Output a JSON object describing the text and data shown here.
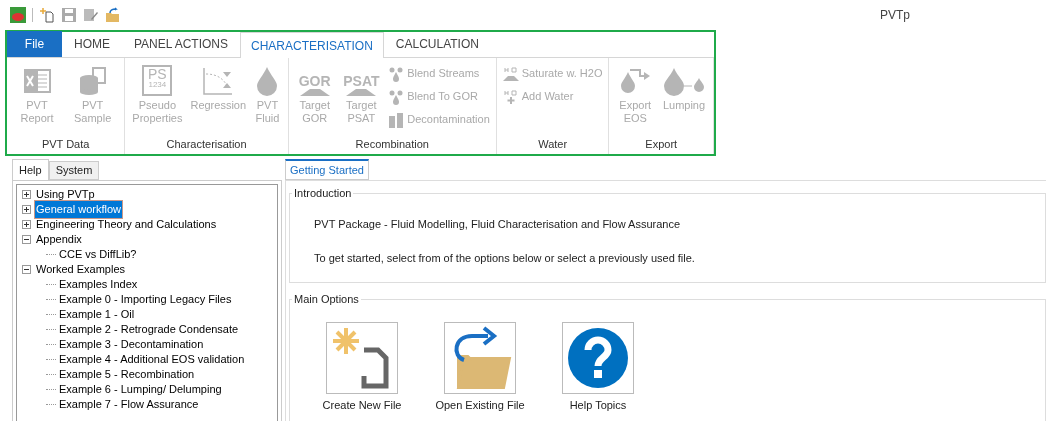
{
  "window": {
    "title": "PVTp"
  },
  "ribbon_tabs": [
    {
      "label": "File",
      "kind": "file"
    },
    {
      "label": "HOME",
      "kind": "tab",
      "selected": false
    },
    {
      "label": "PANEL ACTIONS",
      "kind": "tab",
      "selected": false
    },
    {
      "label": "CHARACTERISATION",
      "kind": "tab",
      "selected": true
    },
    {
      "label": "CALCULATION",
      "kind": "tab",
      "selected": false
    }
  ],
  "ribbon_groups": [
    {
      "label": "PVT Data",
      "items": [
        {
          "kind": "spreadsheet",
          "label": "PVT Report",
          "disabled": true
        },
        {
          "kind": "database",
          "label": "PVT Sample",
          "disabled": true
        }
      ]
    },
    {
      "label": "Characterisation",
      "items": [
        {
          "kind": "pseudo",
          "icon_text": "PS",
          "icon_subtext": "1234",
          "label": "Pseudo Properties",
          "disabled": true
        },
        {
          "kind": "regression",
          "label": "Regression",
          "disabled": true
        },
        {
          "kind": "droplet",
          "label": "PVT Fluid",
          "disabled": true
        }
      ]
    },
    {
      "label": "Recombination",
      "items": [
        {
          "kind": "mound",
          "icon_text": "GOR",
          "label": "Target GOR",
          "disabled": true
        },
        {
          "kind": "mound",
          "icon_text": "PSAT",
          "label": "Target PSAT",
          "disabled": true
        },
        {
          "kind": "stack",
          "items": [
            {
              "kind": "droplets",
              "label": "Blend Streams",
              "disabled": true
            },
            {
              "kind": "droplets",
              "label": "Blend To GOR",
              "disabled": true
            },
            {
              "kind": "decon",
              "label": "Decontamination",
              "disabled": true
            }
          ]
        }
      ]
    },
    {
      "label": "Water",
      "items": [
        {
          "kind": "stack",
          "items": [
            {
              "kind": "water",
              "label": "Saturate w. H2O",
              "disabled": true
            },
            {
              "kind": "addwater",
              "label": "Add Water",
              "disabled": true
            }
          ]
        }
      ]
    },
    {
      "label": "Export",
      "items": [
        {
          "kind": "export",
          "label": "Export EOS",
          "disabled": true
        },
        {
          "kind": "lumping",
          "label": "Lumping",
          "disabled": true
        }
      ]
    }
  ],
  "left_tabs": [
    {
      "label": "Help",
      "selected": true
    },
    {
      "label": "System",
      "selected": false
    }
  ],
  "tree": [
    {
      "label": "Using PVTp",
      "expanded": false,
      "selected": false
    },
    {
      "label": "General workflow",
      "expanded": false,
      "selected": true
    },
    {
      "label": "Engineering Theory and Calculations",
      "expanded": false,
      "selected": false
    },
    {
      "label": "Appendix",
      "expanded": true,
      "selected": false,
      "children": [
        {
          "label": "CCE vs DiffLib?",
          "selected": false
        }
      ]
    },
    {
      "label": "Worked Examples",
      "expanded": true,
      "selected": false,
      "children": [
        {
          "label": "Examples Index",
          "selected": false
        },
        {
          "label": "Example 0 - Importing Legacy Files",
          "selected": false
        },
        {
          "label": "Example 1 - Oil",
          "selected": false
        },
        {
          "label": "Example 2 - Retrograde Condensate",
          "selected": false
        },
        {
          "label": "Example 3 - Decontamination",
          "selected": false
        },
        {
          "label": "Example 4 - Additional EOS validation",
          "selected": false
        },
        {
          "label": "Example 5 - Recombination",
          "selected": false
        },
        {
          "label": "Example 6 - Lumping/ Delumping",
          "selected": false
        },
        {
          "label": "Example 7 - Flow Assurance",
          "selected": false
        }
      ]
    }
  ],
  "doc_tabs": [
    {
      "label": "Getting Started",
      "selected": true
    }
  ],
  "introduction": {
    "title": "Introduction",
    "lines": [
      "PVT Package - Fluid Modelling, Fluid Characterisation and Flow Assurance",
      "To get started, select from of the options below or select a previously used file."
    ]
  },
  "main_options": {
    "title": "Main Options",
    "buttons": [
      {
        "label": "Create New File"
      },
      {
        "label": "Open Existing File"
      },
      {
        "label": "Help Topics"
      }
    ]
  }
}
